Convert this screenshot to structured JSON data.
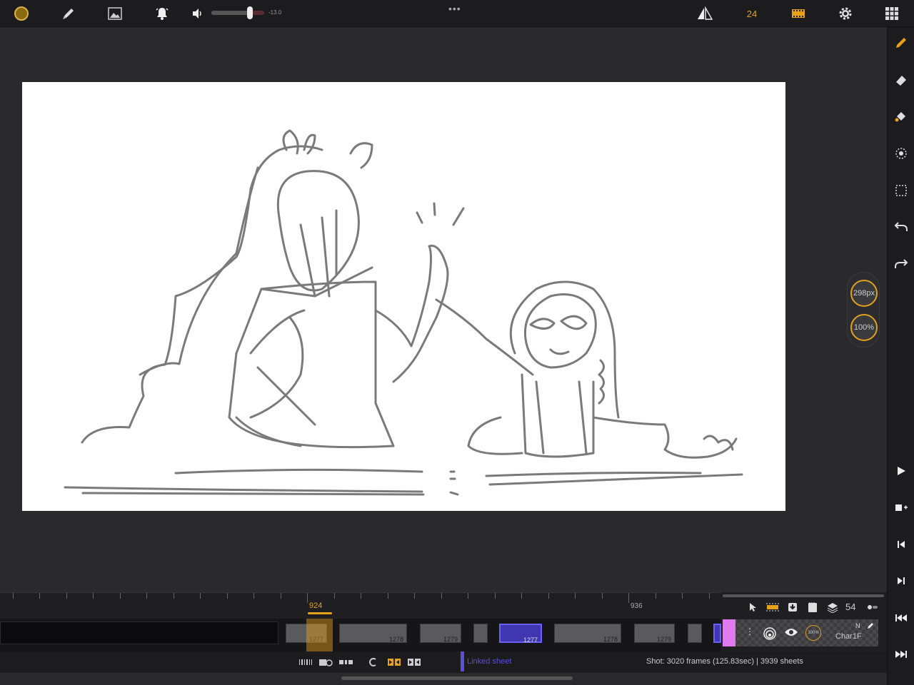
{
  "toolbar": {
    "color_swatch": "#8a6a10",
    "volume_value": "-13.0",
    "volume_level": 0.72,
    "fps": "24",
    "more": "•••"
  },
  "side_pill": {
    "brush_size": "298px",
    "opacity": "100%"
  },
  "timeline": {
    "current_frame": "924",
    "marker_frame": "936",
    "cels": [
      "1277",
      "1278",
      "1279",
      "1277",
      "1278",
      "1279"
    ]
  },
  "bottom_bar": {
    "linked_label": "Linked sheet",
    "shot_info": "Shot: 3020 frames (125.83sec) | 3939 sheets"
  },
  "layer_panel": {
    "count": "54",
    "layer_name": "Char1F",
    "blend_mode": "N",
    "layer_opacity": "100%",
    "layer_color": "#e07af0"
  },
  "colors": {
    "accent": "#e8a21a",
    "linked": "#5a4de0",
    "canvas": "#ffffff"
  }
}
